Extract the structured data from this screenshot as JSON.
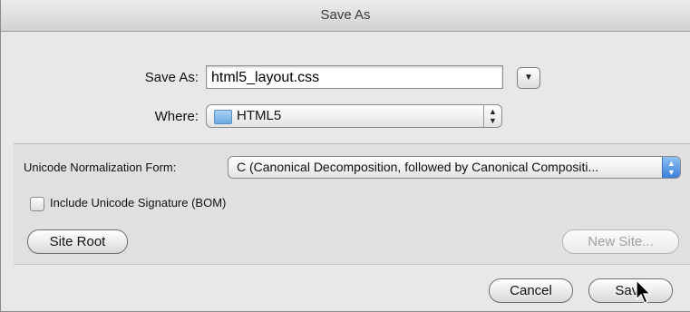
{
  "dialog": {
    "title": "Save As",
    "save_as_label": "Save As:",
    "filename": "html5_layout.css",
    "where_label": "Where:",
    "where_value": "HTML5"
  },
  "options": {
    "normalization_label": "Unicode Normalization Form:",
    "normalization_value": "C (Canonical Decomposition, followed by Canonical Compositi...",
    "bom_label": "Include Unicode Signature (BOM)",
    "bom_checked": false
  },
  "buttons": {
    "site_root": "Site Root",
    "new_site": "New Site...",
    "cancel": "Cancel",
    "save": "Save"
  },
  "icons": {
    "disclosure": "chevron-down-icon",
    "folder": "folder-icon",
    "popup_arrows": "updown-arrows-icon",
    "cursor": "mouse-pointer-icon"
  }
}
